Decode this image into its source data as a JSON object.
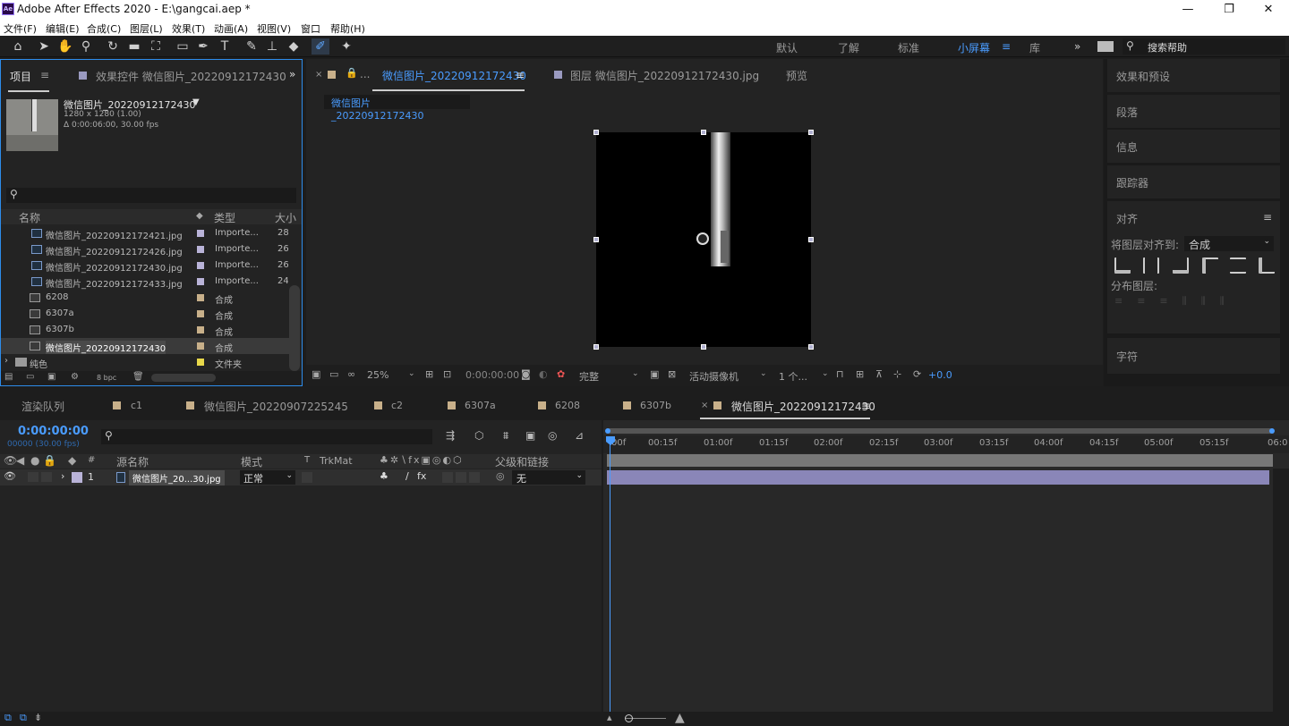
{
  "app": {
    "title": "Adobe After Effects 2020 - E:\\gangcai.aep *",
    "logo": "Ae",
    "controls": [
      "minimize-icon",
      "maximize-icon",
      "close-icon"
    ]
  },
  "menu": [
    "文件(F)",
    "编辑(E)",
    "合成(C)",
    "图层(L)",
    "效果(T)",
    "动画(A)",
    "视图(V)",
    "窗口",
    "帮助(H)"
  ],
  "workspaces": [
    "默认",
    "了解",
    "标准",
    "小屏幕",
    "≡",
    "库"
  ],
  "search": {
    "placeholder": "搜索帮助"
  },
  "project_panel": {
    "tab": "项目",
    "effects_tab": "效果控件 微信图片_20220912172430",
    "comp_name": "微信图片_20220912172430",
    "comp_dims": "1280 x 1280 (1.00)",
    "comp_dur": "Δ 0:00:06:00, 30.00 fps",
    "columns": [
      "名称",
      "类型",
      "大小"
    ],
    "items": [
      {
        "name": "微信图片_20220912172421.jpg",
        "type": "Importe...",
        "size": "28"
      },
      {
        "name": "微信图片_20220912172426.jpg",
        "type": "Importe...",
        "size": "26'"
      },
      {
        "name": "微信图片_20220912172430.jpg",
        "type": "Importe...",
        "size": "26'"
      },
      {
        "name": "微信图片_20220912172433.jpg",
        "type": "Importe...",
        "size": "24("
      },
      {
        "name": "6208",
        "type": "合成",
        "size": ""
      },
      {
        "name": "6307a",
        "type": "合成",
        "size": ""
      },
      {
        "name": "6307b",
        "type": "合成",
        "size": ""
      },
      {
        "name": "微信图片_20220912172430",
        "type": "合成",
        "size": ""
      },
      {
        "name": "纯色",
        "type": "文件夹",
        "size": ""
      }
    ],
    "bpc": "8 bpc"
  },
  "viewer": {
    "tabs": [
      "合成 微信图片_20220912172430",
      "图层 微信图片_20220912172430.jpg",
      "预览"
    ],
    "active_tab": "微信图片_20220912172430",
    "breadcrumb": "微信图片_20220912172430",
    "zoom": "25%",
    "timecode": "0:00:00:00",
    "quality": "完整",
    "camera": "活动摄像机",
    "views": "1 个...",
    "exposure": "+0.0"
  },
  "right_panels": [
    "效果和预设",
    "段落",
    "信息",
    "跟踪器",
    "对齐",
    "字符"
  ],
  "align": {
    "label": "将图层对齐到:",
    "target": "合成",
    "distribute": "分布图层:"
  },
  "timeline": {
    "tabs": [
      "渲染队列",
      "c1",
      "微信图片_20220907225245",
      "c2",
      "6307a",
      "6208",
      "6307b",
      "微信图片_20220912172430"
    ],
    "timecode": "0:00:00:00",
    "fps": "00000 (30.00 fps)",
    "ruler": [
      "00f",
      "00:15f",
      "01:00f",
      "01:15f",
      "02:00f",
      "02:15f",
      "03:00f",
      "03:15f",
      "04:00f",
      "04:15f",
      "05:00f",
      "05:15f",
      "06:0"
    ],
    "headers": {
      "num": "#",
      "source": "源名称",
      "mode": "模式",
      "t": "T",
      "trkmat": "TrkMat",
      "parent": "父级和链接"
    },
    "layer": {
      "num": "1",
      "name": "微信图片_20...30.jpg",
      "mode": "正常",
      "parent": "无"
    }
  }
}
